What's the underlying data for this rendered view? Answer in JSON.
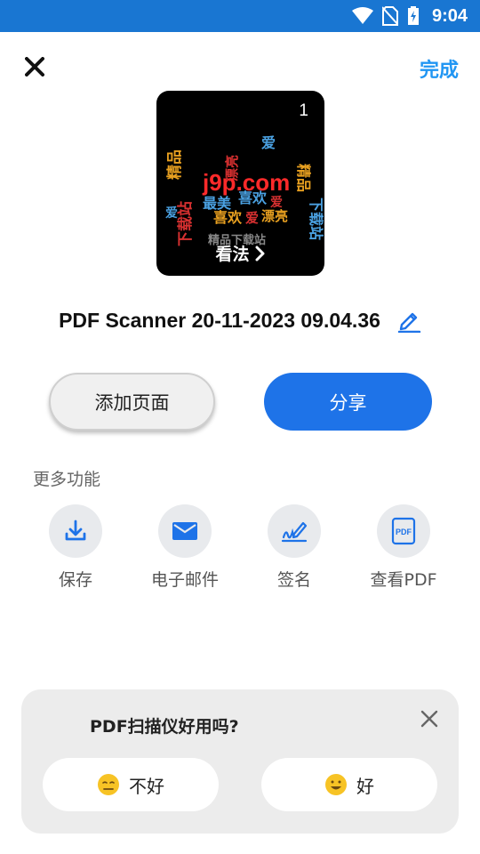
{
  "status_bar": {
    "time": "9:04",
    "bg_color": "#1976d2"
  },
  "header": {
    "close_icon": "close-icon",
    "done_label": "完成"
  },
  "thumbnail": {
    "page_number": "1",
    "view_label": "看法",
    "cloud_words": [
      "j9p.com",
      "精品",
      "下载站",
      "最美",
      "喜欢",
      "爱",
      "漂亮",
      "精品下载站"
    ]
  },
  "document": {
    "title": "PDF Scanner 20-11-2023 09.04.36"
  },
  "actions": {
    "add_page_label": "添加页面",
    "share_label": "分享",
    "share_color": "#1e73e8"
  },
  "more": {
    "title": "更多功能",
    "items": [
      {
        "label": "保存",
        "icon": "download-icon"
      },
      {
        "label": "电子邮件",
        "icon": "mail-icon"
      },
      {
        "label": "签名",
        "icon": "signature-icon"
      },
      {
        "label": "查看PDF",
        "icon": "pdf-icon"
      }
    ],
    "accent_color": "#1e73e8"
  },
  "rating": {
    "question": "PDF扫描仪好用吗?",
    "bad_label": "不好",
    "good_label": "好"
  }
}
